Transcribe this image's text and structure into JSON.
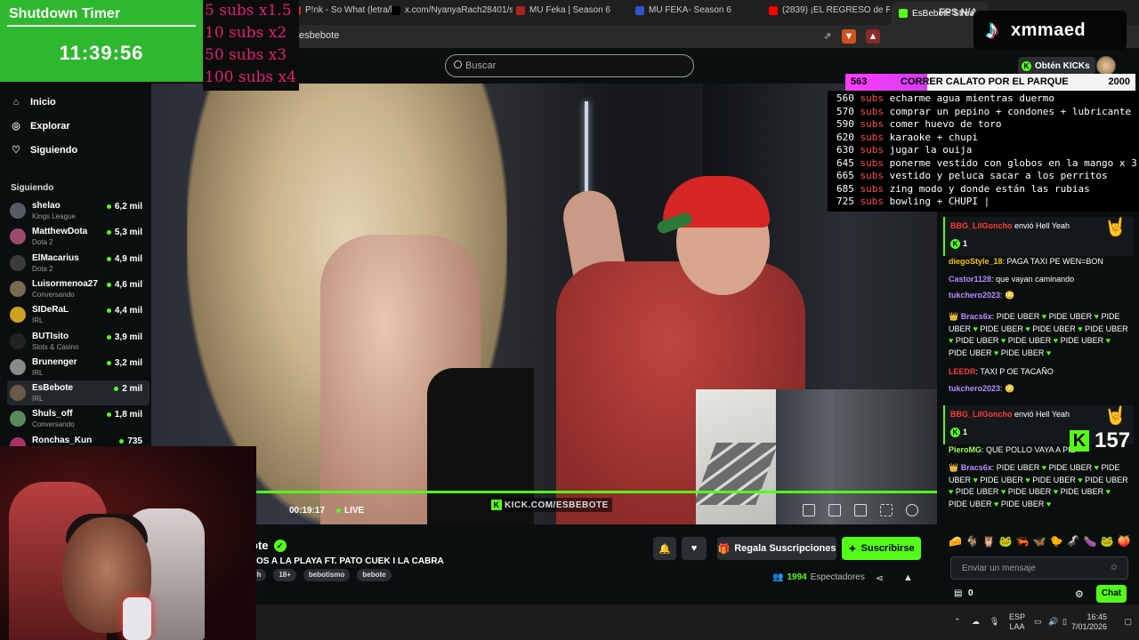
{
  "browser": {
    "tabs": [
      {
        "label": "P!nk - So What (letra/ly",
        "color": "#cc3333"
      },
      {
        "label": "x.com/NyanyaRach28401/stat",
        "color": "#000000"
      },
      {
        "label": "MU Feka | Season 6",
        "color": "#aa2222"
      },
      {
        "label": "MU FEKA- Season 6",
        "color": "#3355cc"
      },
      {
        "label": "(2839) ¡EL REGRESO de RO",
        "color": "#ff0000"
      },
      {
        "label": "EsBebote Stream",
        "color": "#53fc18"
      }
    ],
    "url": "esbebote"
  },
  "kick": {
    "search_placeholder": "Buscar",
    "obten_label": "Obtén KICKs",
    "nav": [
      {
        "label": "Inicio",
        "icon": "home-icon"
      },
      {
        "label": "Explorar",
        "icon": "compass-icon"
      },
      {
        "label": "Siguiendo",
        "icon": "heart-icon"
      }
    ],
    "following_title": "Siguiendo",
    "channels": [
      {
        "name": "shelao",
        "category": "Kings League",
        "viewers": "6,2 mil",
        "color": "#555c66"
      },
      {
        "name": "MatthewDota",
        "category": "Dota 2",
        "viewers": "5,3 mil",
        "color": "#9a4a6a"
      },
      {
        "name": "ElMacarius",
        "category": "Dota 2",
        "viewers": "4,9 mil",
        "color": "#3a3a3a"
      },
      {
        "name": "Luisormenoa27",
        "category": "Conversando",
        "viewers": "4,6 mil",
        "color": "#7a6a50"
      },
      {
        "name": "SIDeRaL",
        "category": "IRL",
        "viewers": "4,4 mil",
        "color": "#d0a020"
      },
      {
        "name": "BUTIsito",
        "category": "Slots & Casino",
        "viewers": "3,9 mil",
        "color": "#222222"
      },
      {
        "name": "Brunenger",
        "category": "IRL",
        "viewers": "3,2 mil",
        "color": "#8a8a8a"
      },
      {
        "name": "EsBebote",
        "category": "IRL",
        "viewers": "2 mil",
        "color": "#6a5a4a"
      },
      {
        "name": "Shuls_off",
        "category": "Conversando",
        "viewers": "1,8 mil",
        "color": "#5a8a5a"
      },
      {
        "name": "Ronchas_Kun",
        "category": "",
        "viewers": "735",
        "color": "#aa3366"
      }
    ],
    "player": {
      "time": "00:19:17",
      "live_label": "LIVE",
      "watermark": "KICK.COM/ESBEBOTE"
    },
    "channel_name": "ote",
    "stream_title": "OS A LA PLAYA FT. PATO CUEK I LA CABRA",
    "tags": [
      "sh",
      "18+",
      "bebotismo",
      "bebote"
    ],
    "gift_label": "Regala Suscripciones",
    "subscribe_label": "Suscribirse",
    "viewers_count": "1994",
    "viewers_label": "Espectadores",
    "chat_placeholder": "Enviar un mensaje",
    "chat_button": "Chat",
    "kicks_balance": "0",
    "emotes": [
      "🧀",
      "🐐",
      "🦉",
      "🐸",
      "🦐",
      "🦋",
      "🐤",
      "🦨",
      "🍆",
      "🐸",
      "🍑"
    ]
  },
  "chat": [
    {
      "kind": "gift",
      "user": "BBG_LilGoncho",
      "text": "envió Hell Yeah",
      "count": "1"
    },
    {
      "kind": "msg",
      "user": "diegoStyle_18",
      "color": "gold",
      "text": "PAGA TAXI PE WEN=BON"
    },
    {
      "kind": "msg",
      "user": "Castor1128",
      "color": "purple",
      "text": "que vayan caminando"
    },
    {
      "kind": "emote",
      "user": "tukchero2023"
    },
    {
      "kind": "heart",
      "user": "Bracs6x",
      "text": "PIDE UBER"
    },
    {
      "kind": "msg",
      "user": "LEEDR",
      "color": "red",
      "text": "TAXI P OE TACAÑO"
    },
    {
      "kind": "emote",
      "user": "tukchero2023"
    },
    {
      "kind": "gift",
      "user": "BBG_LilGoncho",
      "text": "envió Hell Yeah",
      "count": "1"
    },
    {
      "kind": "msg",
      "user": "PieroMG",
      "color": "lime",
      "text": "QUE POLLO VAYA A PIE"
    },
    {
      "kind": "heart",
      "user": "Bracs6x",
      "text": "PIDE UBER"
    }
  ],
  "overlay": {
    "timer_title": "Shutdown Timer",
    "timer_value": "11:39:56",
    "multipliers": [
      "5 subs x1.5",
      "10 subs x2",
      "50 subs x3",
      "100 subs x4"
    ],
    "fps_label": "FPS N/A",
    "tiktok_user": "xmmaed",
    "goal": {
      "current": "563",
      "text": "CORRER CALATO POR EL PARQUE",
      "target": "2000",
      "progress": 0.2815
    },
    "sub_goals": [
      {
        "n": "560",
        "unit": "subs",
        "task": "echarme agua mientras duermo"
      },
      {
        "n": "570",
        "unit": "subs",
        "task": "comprar un pepino + condones + lubricante"
      },
      {
        "n": "590",
        "unit": "subs",
        "task": "comer huevo de toro"
      },
      {
        "n": "620",
        "unit": "subs",
        "task": "karaoke + chupi"
      },
      {
        "n": "630",
        "unit": "subs",
        "task": "jugar la ouija"
      },
      {
        "n": "645",
        "unit": "subs",
        "task": "ponerme vestido con globos en la mango x 3"
      },
      {
        "n": "665",
        "unit": "subs",
        "task": "vestido y peluca  sacar a los perritos"
      },
      {
        "n": "685",
        "unit": "subs",
        "task": "zing modo y donde están las rubias"
      },
      {
        "n": "725",
        "unit": "subs",
        "task": " bowling + CHUPI |"
      }
    ],
    "kick_count": "157"
  },
  "taskbar": {
    "lang_top": "ESP",
    "lang_bottom": "LAA",
    "time": "16:45",
    "date": "7/01/2026"
  }
}
